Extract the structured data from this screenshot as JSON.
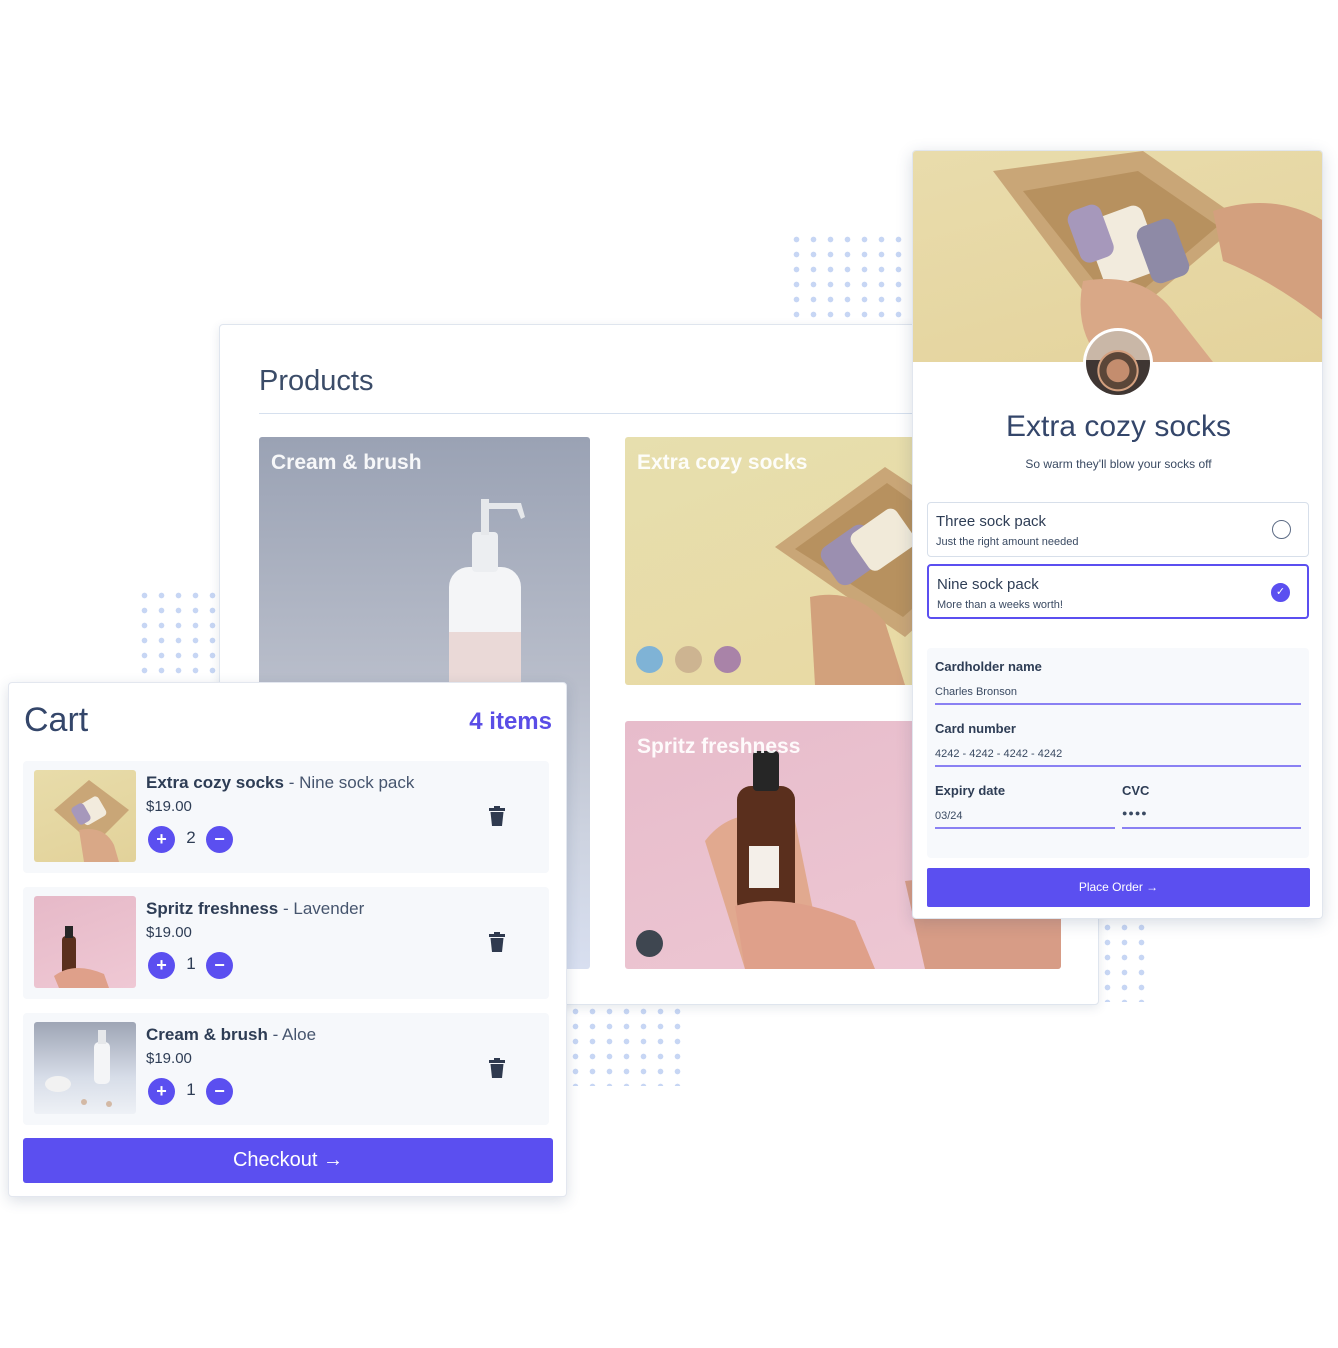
{
  "products": {
    "title": "Products",
    "cards": [
      {
        "name": "Cream & brush",
        "swatches": []
      },
      {
        "name": "Extra cozy socks",
        "swatches": [
          "#7fb3d6",
          "#cdb491",
          "#a983a8"
        ]
      },
      {
        "name": "Spritz freshness",
        "swatches": [
          "#3e4650"
        ]
      }
    ]
  },
  "cart": {
    "title": "Cart",
    "count": "4 items",
    "items": [
      {
        "product": "Extra cozy socks",
        "sep": " - ",
        "variant": "Nine sock pack",
        "price": "$19.00",
        "qty": "2"
      },
      {
        "product": "Spritz freshness",
        "sep": " - ",
        "variant": "Lavender",
        "price": "$19.00",
        "qty": "1"
      },
      {
        "product": "Cream & brush",
        "sep": " - ",
        "variant": "Aloe",
        "price": "$19.00",
        "qty": "1"
      }
    ],
    "plus_glyph": "+",
    "minus_glyph": "−",
    "checkout_label": "Checkout →"
  },
  "detail": {
    "title": "Extra cozy socks",
    "subtitle": "So warm they'll blow your socks off",
    "options": [
      {
        "title": "Three sock pack",
        "desc": "Just the right amount needed",
        "selected": false
      },
      {
        "title": "Nine sock pack",
        "desc": "More than a weeks worth!",
        "selected": true
      }
    ],
    "form": {
      "cardholder_label": "Cardholder name",
      "cardholder_value": "Charles Bronson",
      "card_label": "Card number",
      "card_value": "4242 - 4242 - 4242 - 4242",
      "expiry_label": "Expiry date",
      "expiry_value": "03/24",
      "cvc_label": "CVC",
      "cvc_value": "●●●●"
    },
    "place_order_label": "Place Order →",
    "check_glyph": "✓"
  },
  "colors": {
    "accent": "#5b4ff0",
    "text": "#34466a"
  }
}
